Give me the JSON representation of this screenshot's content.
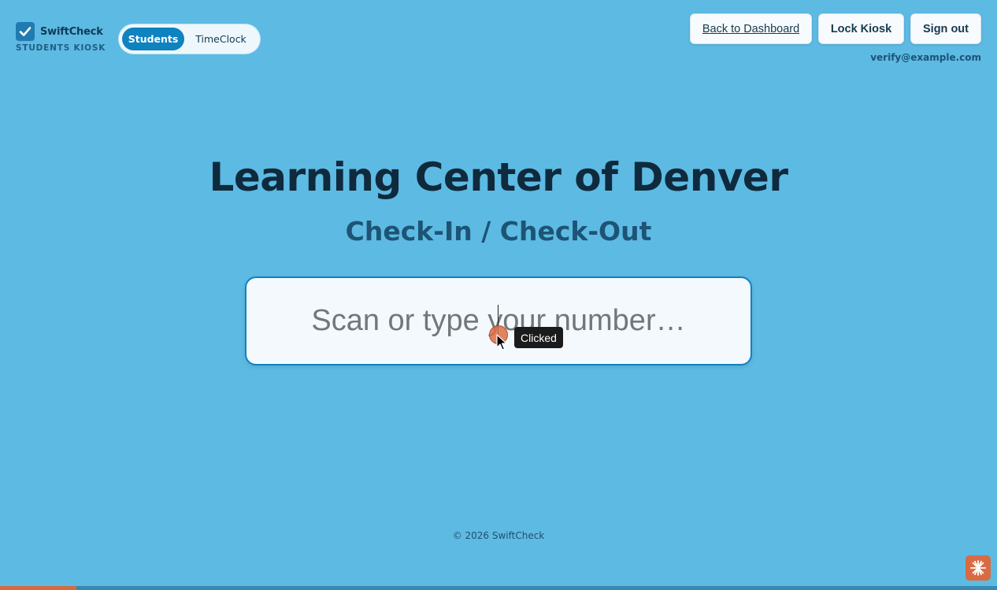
{
  "brand": {
    "name": "SwiftCheck",
    "subtitle": "STUDENTS KIOSK"
  },
  "mode_toggle": {
    "options": [
      {
        "label": "Students",
        "selected": true
      },
      {
        "label": "TimeClock",
        "selected": false
      }
    ]
  },
  "header": {
    "back_label": "Back to Dashboard",
    "lock_label": "Lock Kiosk",
    "signout_label": "Sign out",
    "user_email": "verify@example.com"
  },
  "main": {
    "title": "Learning Center of Denver",
    "subtitle": "Check-In / Check-Out",
    "scan_input": {
      "value": "",
      "placeholder": "Scan or type your number…"
    }
  },
  "overlay": {
    "tooltip": "Clicked"
  },
  "footer": {
    "copyright": "© 2026 SwiftCheck"
  },
  "colors": {
    "background": "#5dbae3",
    "accent": "#0f82c0",
    "title": "#0f2a3d",
    "help_button": "#d96b43"
  },
  "icons": {
    "brand": "checkbox-check-icon",
    "help": "sparkle-icon",
    "cursor": "mouse-pointer-icon"
  }
}
